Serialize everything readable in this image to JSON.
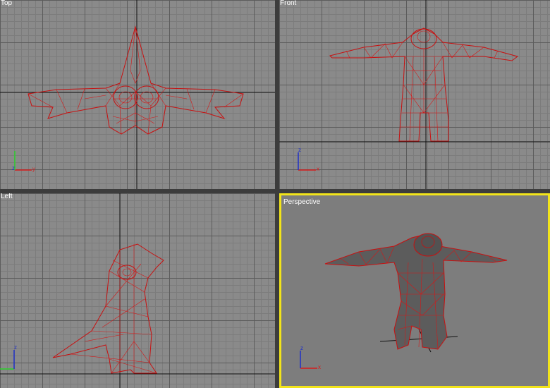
{
  "viewports": {
    "top": {
      "label": "Top",
      "axis_h": "y",
      "axis_v": "z"
    },
    "front": {
      "label": "Front",
      "axis_h": "x",
      "axis_v": "z"
    },
    "left": {
      "label": "Left",
      "axis_h": "",
      "axis_v": "z"
    },
    "perspective": {
      "label": "Perspective",
      "axis_h": "x",
      "axis_v": "z",
      "active": true
    }
  },
  "colors": {
    "viewport_bg": "#8a8a8a",
    "grid_major": "#5c5c5c",
    "grid_minor": "#7c7c7c",
    "wireframe": "#c81010",
    "active_border": "#f2e41a",
    "separator": "#3c3c3c"
  }
}
